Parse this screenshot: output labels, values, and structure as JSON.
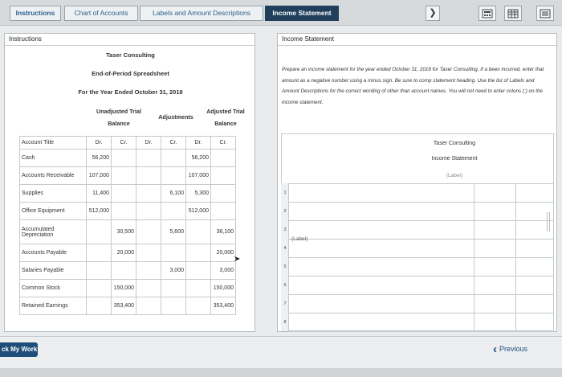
{
  "tabs": [
    {
      "label": "Instructions"
    },
    {
      "label": "Chart of Accounts"
    },
    {
      "label": "Labels and Amount Descriptions"
    },
    {
      "label": "Income Statement"
    }
  ],
  "toolbar": {
    "chevron": "❯",
    "icon1": "calculator-icon",
    "icon2": "grid-icon",
    "icon3": "list-icon"
  },
  "left_panel": {
    "title": "Instructions",
    "company": "Taser Consulting",
    "sheet_name": "End-of-Period Spreadsheet",
    "period": "For the Year Ended October 31, 2018",
    "col_groups": {
      "unadjusted": "Unadjusted Trial Balance",
      "adjustments": "Adjustments",
      "adjusted": "Adjusted Trial Balance"
    },
    "header_row": [
      "Account Title",
      "Dr.",
      "Cr.",
      "Dr.",
      "Cr.",
      "Dr.",
      "Cr."
    ],
    "rows": [
      [
        "Cash",
        "56,200",
        "",
        "",
        "",
        "56,200",
        ""
      ],
      [
        "Accounts Receivable",
        "107,000",
        "",
        "",
        "",
        "107,000",
        ""
      ],
      [
        "Supplies",
        "11,400",
        "",
        "",
        "6,100",
        "5,300",
        ""
      ],
      [
        "Office Equipment",
        "512,000",
        "",
        "",
        "",
        "512,000",
        ""
      ],
      [
        "Accumulated Depreciation",
        "",
        "30,500",
        "",
        "5,600",
        "",
        "36,100"
      ],
      [
        "Accounts Payable",
        "",
        "20,000",
        "",
        "",
        "",
        "20,000"
      ],
      [
        "Salaries Payable",
        "",
        "",
        "",
        "3,000",
        "",
        "3,000"
      ],
      [
        "Common Stock",
        "",
        "150,000",
        "",
        "",
        "",
        "150,000"
      ],
      [
        "Retained Earnings",
        "",
        "353,400",
        "",
        "",
        "",
        "353,400"
      ]
    ]
  },
  "right_panel": {
    "title": "Income Statement",
    "instructions": "Prepare an income statement for the year ended October 31, 2018 for Taser Consulting. If a been incurred, enter that amount as a negative number using a minus sign. Be sure to comp statement heading. Use the list of Labels and Amount Descriptions for the correct wording of other than account names. You will not need to enter colons (:) on the income statement.",
    "company": "Taser Consulting",
    "statement": "Income Statement",
    "label_placeholder": "(Label)",
    "row_label": "(Label)",
    "row_numbers": [
      "1",
      "2",
      "3",
      "4",
      "5",
      "6",
      "7",
      "8"
    ]
  },
  "bottom": {
    "check_label": "ck My Work",
    "previous_label": "Previous"
  }
}
